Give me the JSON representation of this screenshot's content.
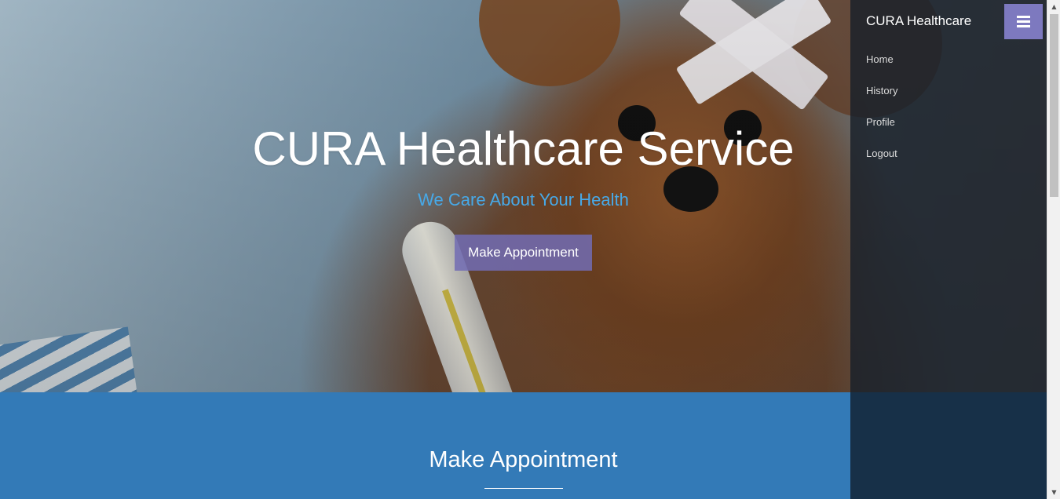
{
  "hero": {
    "title": "CURA Healthcare Service",
    "subtitle": "We Care About Your Health",
    "cta_label": "Make Appointment"
  },
  "appointment_section": {
    "title": "Make Appointment"
  },
  "sidebar": {
    "brand": "CURA Healthcare",
    "items": [
      {
        "label": "Home"
      },
      {
        "label": "History"
      },
      {
        "label": "Profile"
      },
      {
        "label": "Logout"
      }
    ],
    "toggle_icon": "menu-icon"
  },
  "colors": {
    "subtitle": "#47a9e8",
    "cta_background": "#726cb4",
    "section_background": "#337ab7",
    "sidebar_background": "#18202a",
    "toggle_background": "#7d79bf"
  }
}
